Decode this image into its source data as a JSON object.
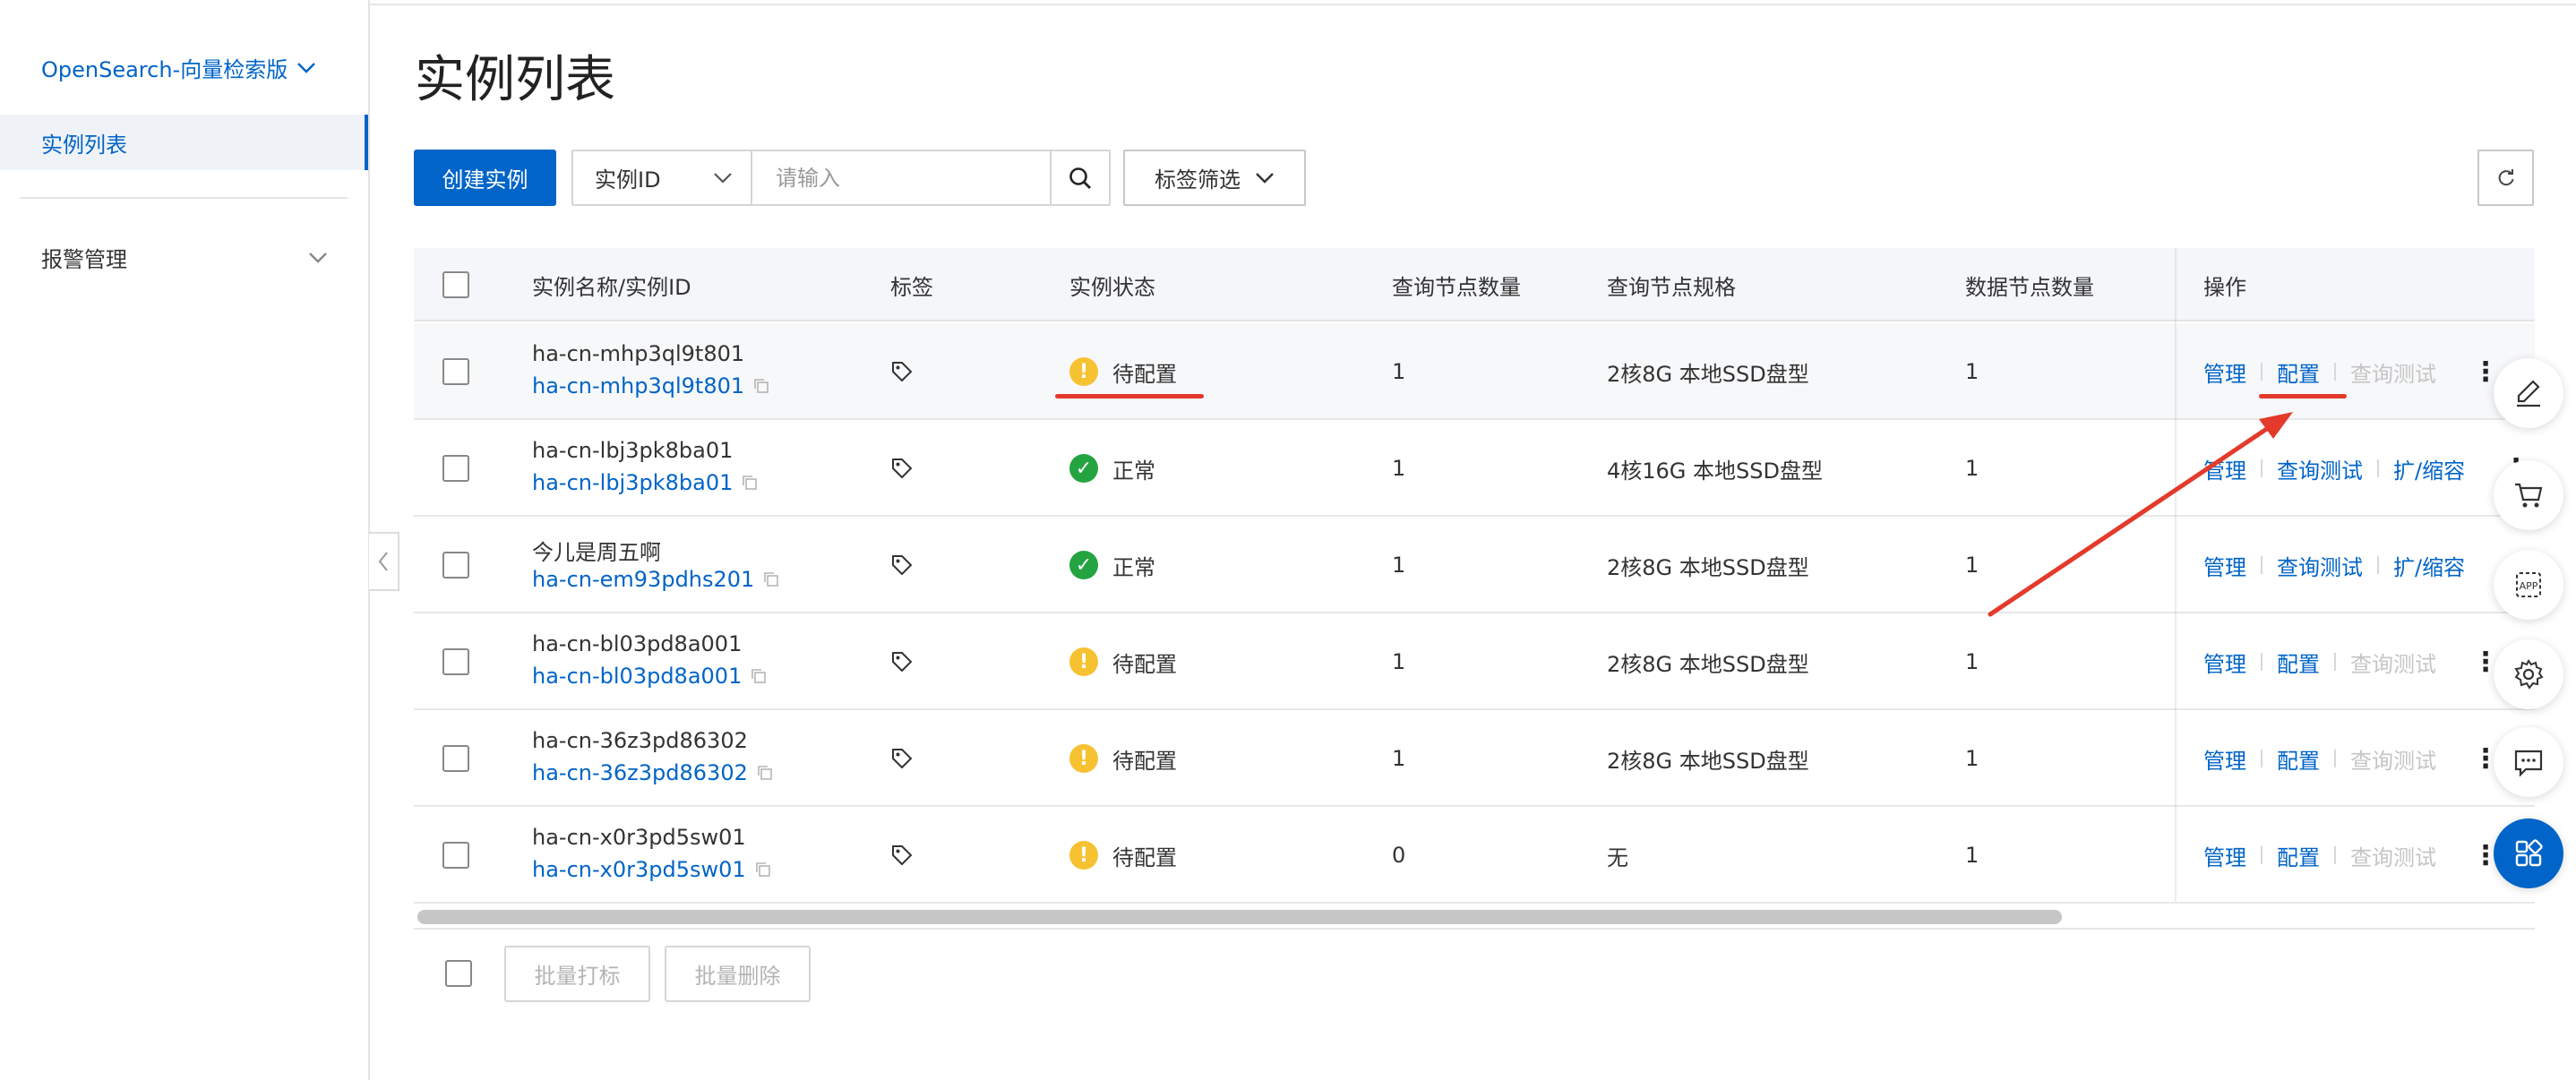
{
  "sidebar": {
    "product_name": "OpenSearch-向量检索版",
    "active_item": "实例列表",
    "alarm_item": "报警管理"
  },
  "page": {
    "title": "实例列表"
  },
  "toolbar": {
    "create_label": "创建实例",
    "search_field": "实例ID",
    "search_placeholder": "请输入",
    "tag_filter_label": "标签筛选"
  },
  "table": {
    "headers": {
      "name": "实例名称/实例ID",
      "tags": "标签",
      "status": "实例状态",
      "query_nodes": "查询节点数量",
      "query_spec": "查询节点规格",
      "data_nodes": "数据节点数量",
      "ops": "操作"
    },
    "rows": [
      {
        "name": "ha-cn-mhp3ql9t801",
        "id": "ha-cn-mhp3ql9t801",
        "status": "待配置",
        "query_nodes": "1",
        "query_spec": "2核8G 本地SSD盘型",
        "data_nodes": "1",
        "op1": "管理",
        "op2": "配置",
        "op3": "查询测试"
      },
      {
        "name": "ha-cn-lbj3pk8ba01",
        "id": "ha-cn-lbj3pk8ba01",
        "status": "正常",
        "query_nodes": "1",
        "query_spec": "4核16G 本地SSD盘型",
        "data_nodes": "1",
        "op1": "管理",
        "op2": "查询测试",
        "op3": "扩/缩容"
      },
      {
        "name": "今儿是周五啊",
        "id": "ha-cn-em93pdhs201",
        "status": "正常",
        "query_nodes": "1",
        "query_spec": "2核8G 本地SSD盘型",
        "data_nodes": "1",
        "op1": "管理",
        "op2": "查询测试",
        "op3": "扩/缩容"
      },
      {
        "name": "ha-cn-bl03pd8a001",
        "id": "ha-cn-bl03pd8a001",
        "status": "待配置",
        "query_nodes": "1",
        "query_spec": "2核8G 本地SSD盘型",
        "data_nodes": "1",
        "op1": "管理",
        "op2": "配置",
        "op3": "查询测试"
      },
      {
        "name": "ha-cn-36z3pd86302",
        "id": "ha-cn-36z3pd86302",
        "status": "待配置",
        "query_nodes": "1",
        "query_spec": "2核8G 本地SSD盘型",
        "data_nodes": "1",
        "op1": "管理",
        "op2": "配置",
        "op3": "查询测试"
      },
      {
        "name": "ha-cn-x0r3pd5sw01",
        "id": "ha-cn-x0r3pd5sw01",
        "status": "待配置",
        "query_nodes": "0",
        "query_spec": "无",
        "data_nodes": "1",
        "op1": "管理",
        "op2": "配置",
        "op3": "查询测试"
      }
    ]
  },
  "footer": {
    "batch_tag_label": "批量打标",
    "batch_delete_label": "批量删除"
  },
  "colors": {
    "accent": "#0064c8",
    "brand_orange": "#ff6a00",
    "warn": "#f7c232",
    "ok": "#23a440",
    "annotation_red": "#e43a2b"
  },
  "icons": {
    "float_tools": [
      "edit-icon",
      "cart-icon",
      "app-icon",
      "settings-icon",
      "chat-icon",
      "apps-grid-icon"
    ]
  }
}
